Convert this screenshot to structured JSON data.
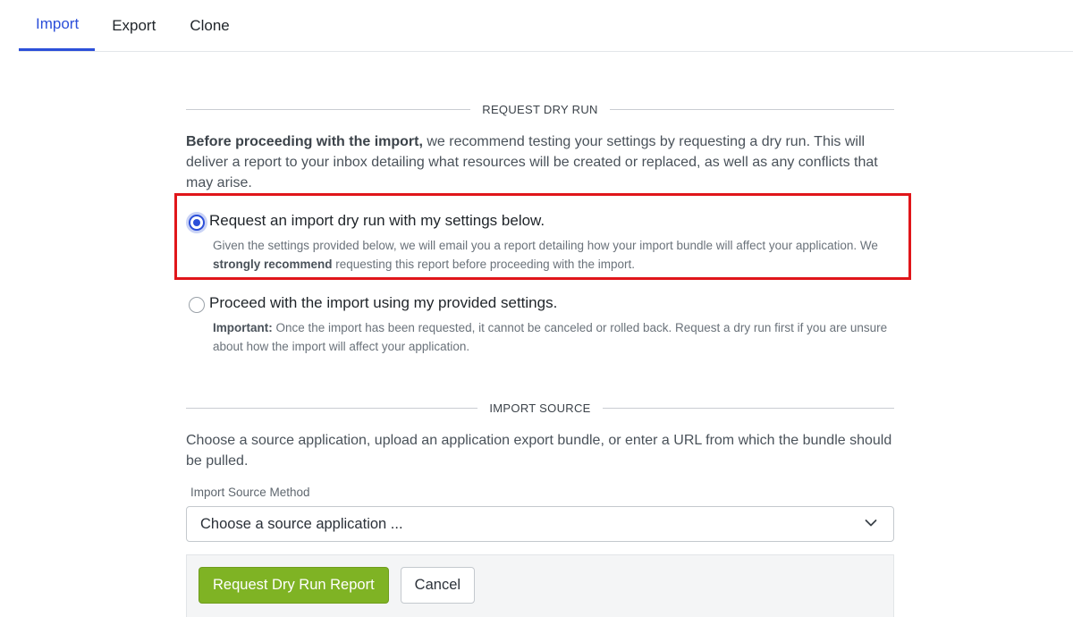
{
  "tabs": [
    {
      "label": "Import",
      "active": true
    },
    {
      "label": "Export",
      "active": false
    },
    {
      "label": "Clone",
      "active": false
    }
  ],
  "dry_run_section": {
    "header": "REQUEST DRY RUN",
    "intro_bold": "Before proceeding with the import,",
    "intro_rest": " we recommend testing your settings by requesting a dry run. This will deliver a report to your inbox detailing what resources will be created or replaced, as well as any conflicts that may arise.",
    "options": [
      {
        "title": "Request an import dry run with my settings below.",
        "desc_part1": "Given the settings provided below, we will email you a report detailing how your import bundle will affect your application. We ",
        "desc_bold": "strongly recommend",
        "desc_part2": " requesting this report before proceeding with the import.",
        "checked": true
      },
      {
        "title": "Proceed with the import using my provided settings.",
        "desc_bold": "Important:",
        "desc_part2": " Once the import has been requested, it cannot be canceled or rolled back. Request a dry run first if you are unsure about how the import will affect your application.",
        "checked": false
      }
    ]
  },
  "import_source_section": {
    "header": "IMPORT SOURCE",
    "description": "Choose a source application, upload an application export bundle, or enter a URL from which the bundle should be pulled.",
    "field_label": "Import Source Method",
    "select_value": "Choose a source application ..."
  },
  "actions": {
    "primary_label": "Request Dry Run Report",
    "secondary_label": "Cancel"
  },
  "colors": {
    "accent": "#2c4fd9",
    "primary_button": "#7fb324",
    "highlight": "#e0161a"
  },
  "icons": {
    "select_chevron": "chevron-down-icon"
  }
}
